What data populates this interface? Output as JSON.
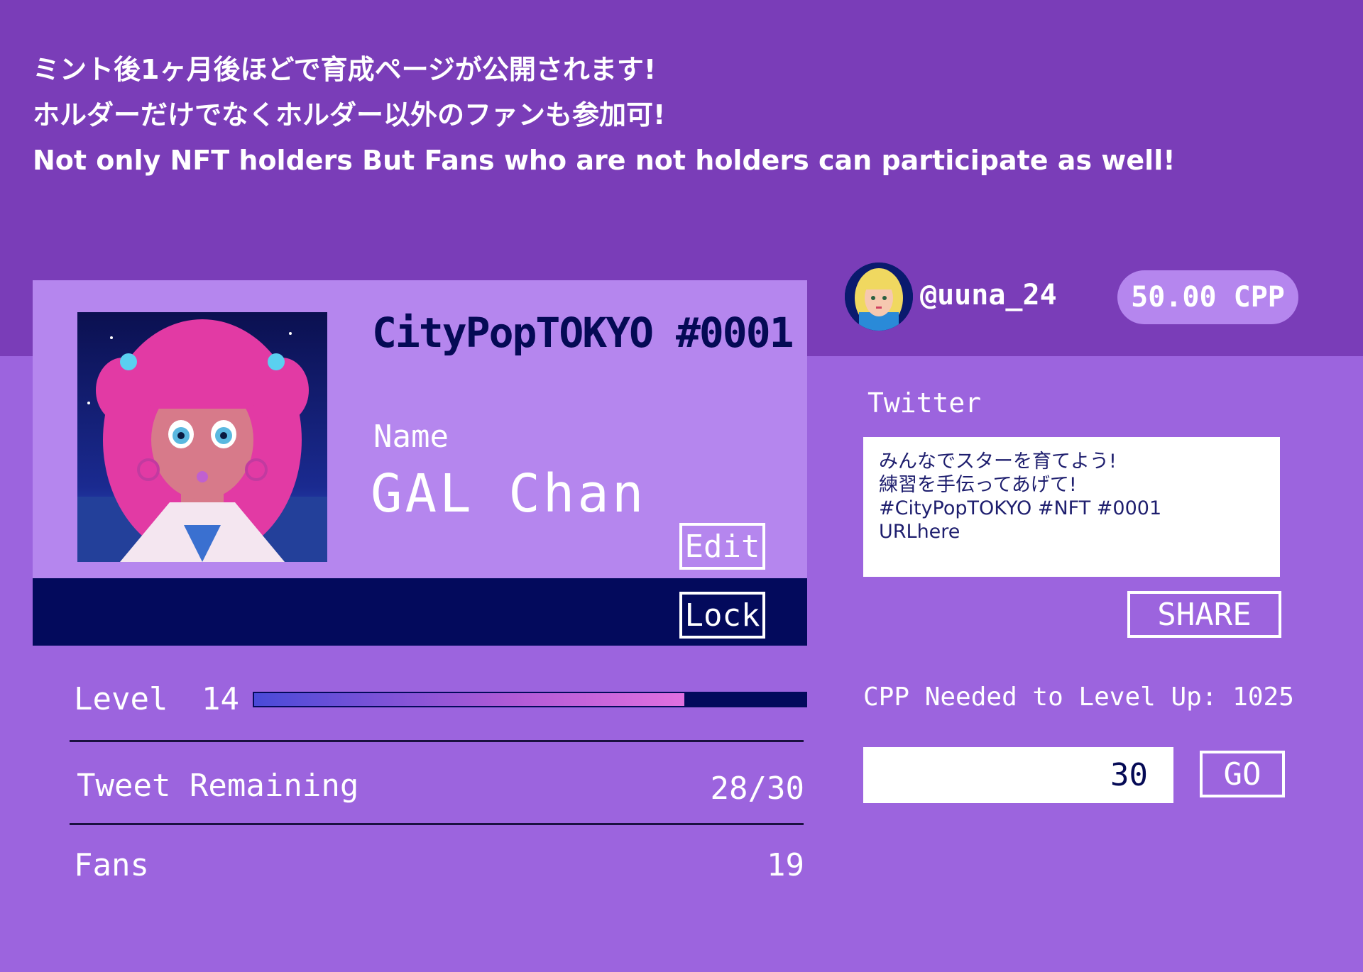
{
  "announcement": {
    "line1": "ミント後1ヶ月後ほどで育成ページが公開されます!",
    "line2": "ホルダーだけでなくホルダー以外のファンも参加可!",
    "line3": "Not only NFT holders But Fans who are not holders can participate as well!"
  },
  "card": {
    "title": "CityPopTOKYO #0001",
    "name_label": "Name",
    "name_value": "GAL Chan",
    "edit_label": "Edit",
    "lock_label": "Lock"
  },
  "stats": {
    "level_label": "Level",
    "level_value": "14",
    "level_progress": 0.78,
    "tweet_label": "Tweet Remaining",
    "tweet_value": "28/30",
    "fans_label": "Fans",
    "fans_value": "19"
  },
  "user": {
    "username": "@uuna_24",
    "balance": "50.00 CPP"
  },
  "twitter": {
    "label": "Twitter",
    "tweet_text": "みんなでスターを育てよう!\n練習を手伝ってあげて!\n#CityPopTOKYO #NFT #0001\nURLhere",
    "share_label": "SHARE"
  },
  "levelup": {
    "cpp_needed": "CPP Needed to Level Up: 1025",
    "amount": "30",
    "go_label": "GO"
  },
  "colors": {
    "top_band": "#7a3db8",
    "background": "#9c64de",
    "card": "#b586ee",
    "navy": "#030a5c"
  },
  "icons": {
    "card_avatar": "anime-girl-portrait",
    "user_avatar": "blonde-girl-avatar"
  }
}
